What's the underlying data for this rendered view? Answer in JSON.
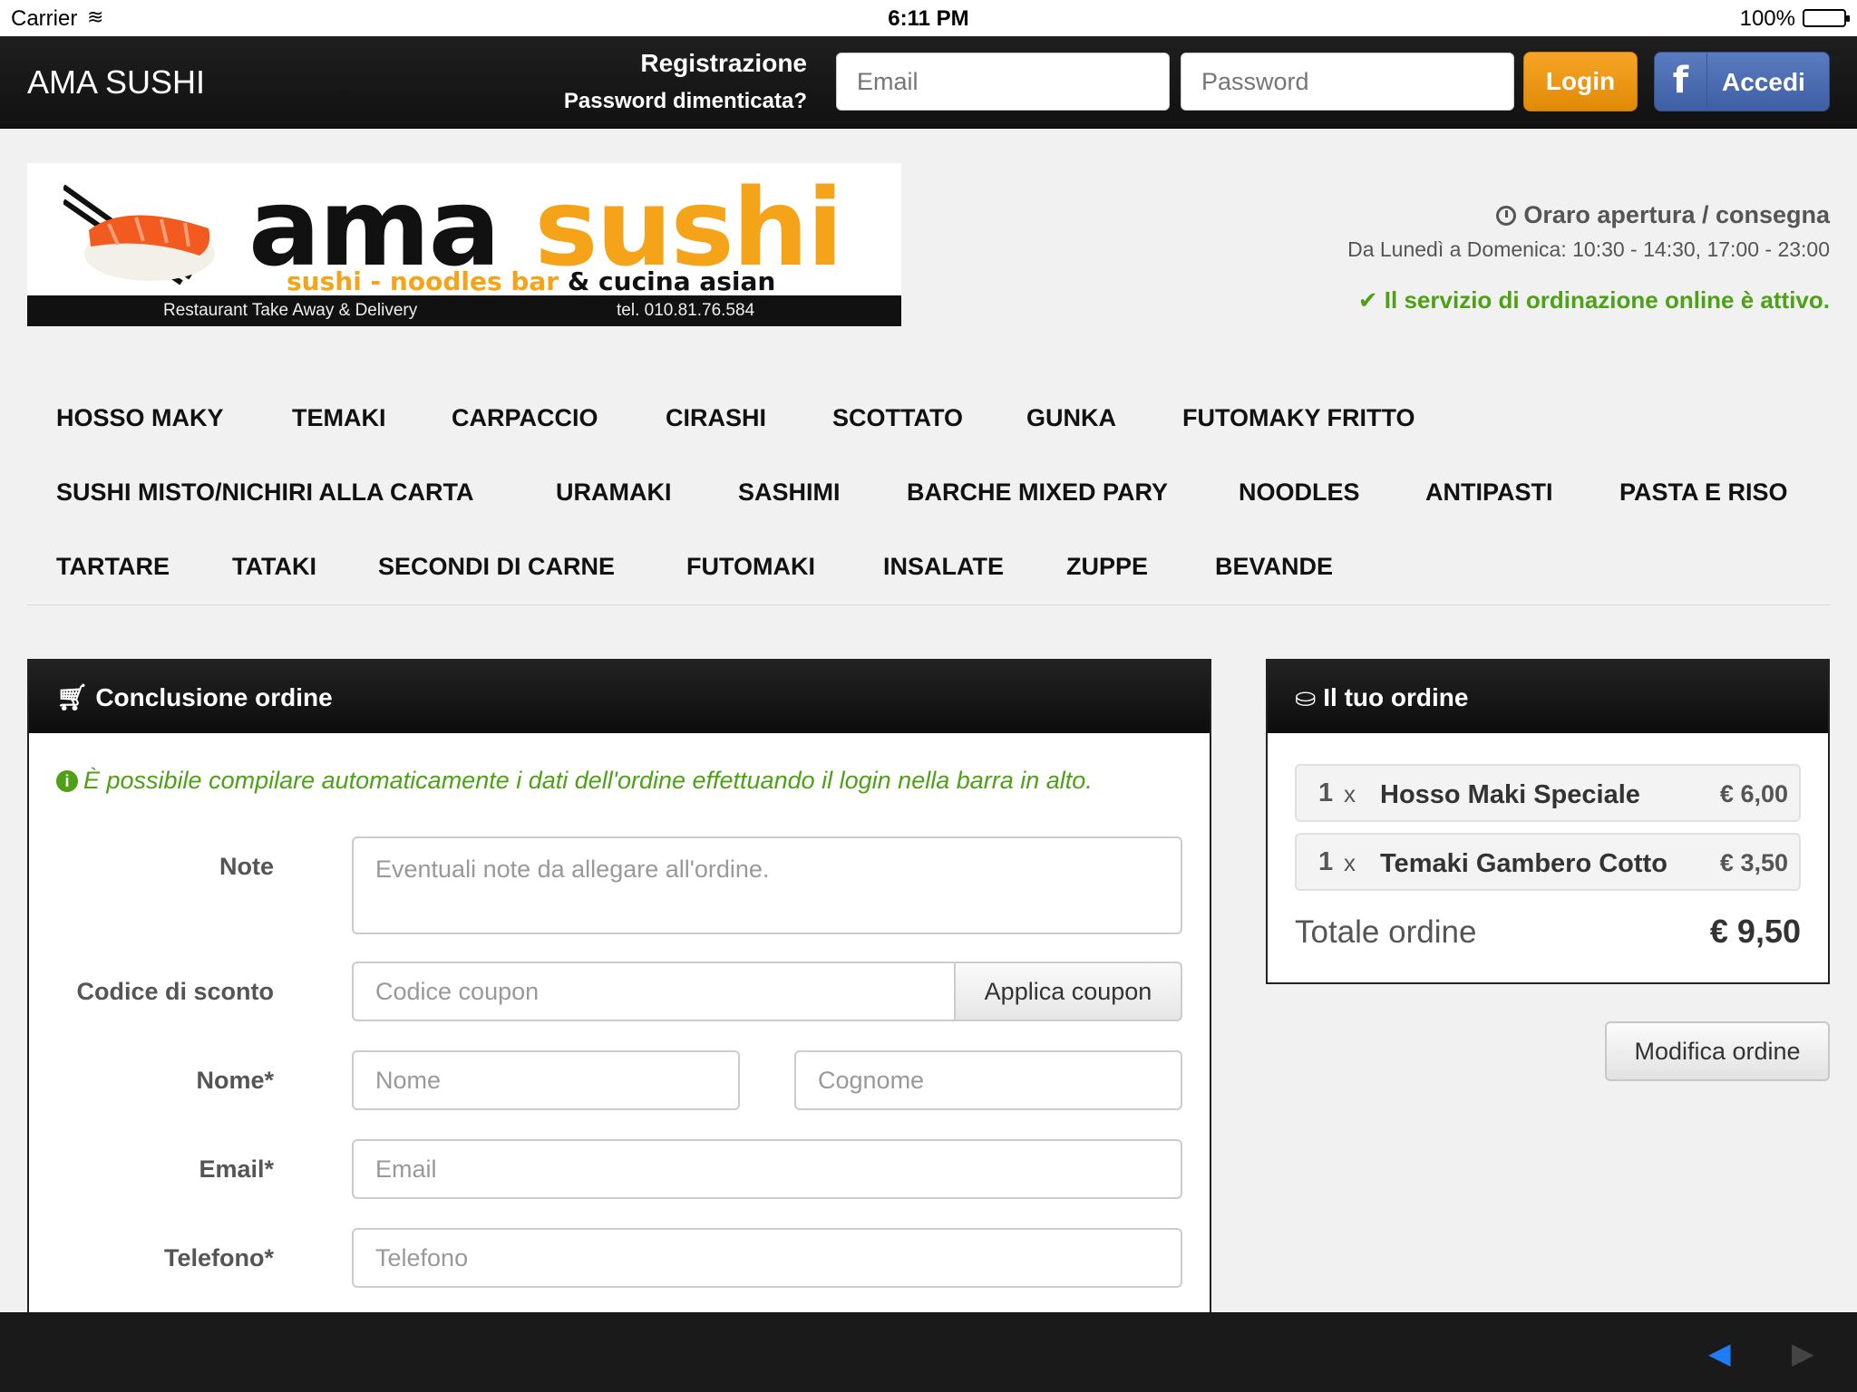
{
  "status_bar": {
    "carrier": "Carrier",
    "time": "6:11 PM",
    "battery": "100%"
  },
  "navbar": {
    "brand": "AMA SUSHI",
    "register": "Registrazione",
    "forgot_password": "Password dimenticata?",
    "email_placeholder": "Email",
    "password_placeholder": "Password",
    "login_label": "Login",
    "fb_label": "Accedi"
  },
  "logo": {
    "word_ama": "ama",
    "word_sushi": "sushi",
    "tagline_orange": "sushi - noodles bar",
    "tagline_dark": "& cucina asian",
    "takeaway": "Restaurant Take Away & Delivery",
    "tel": "tel. 010.81.76.584"
  },
  "hours": {
    "title": "Oraro apertura / consegna",
    "text": "Da Lunedì a Domenica: 10:30 - 14:30, 17:00 - 23:00",
    "service": "Il servizio di ordinazione online è attivo."
  },
  "categories": [
    "HOSSO MAKY",
    "TEMAKI",
    "CARPACCIO",
    "CIRASHI",
    "SCOTTATO",
    "GUNKA",
    "FUTOMAKY FRITTO",
    "SUSHI MISTO/NICHIRI ALLA CARTA",
    "URAMAKI",
    "SASHIMI",
    "BARCHE MIXED PARY",
    "NOODLES",
    "ANTIPASTI",
    "PASTA E RISO",
    "TARTARE",
    "TATAKI",
    "SECONDI DI CARNE",
    "FUTOMAKI",
    "INSALATE",
    "ZUPPE",
    "BEVANDE"
  ],
  "checkout": {
    "title": "Conclusione ordine",
    "info": "È possibile compilare automaticamente i dati dell'ordine effettuando il login nella barra in alto.",
    "note_label": "Note",
    "note_placeholder": "Eventuali note da allegare all'ordine.",
    "coupon_label": "Codice di sconto",
    "coupon_placeholder": "Codice coupon",
    "coupon_button": "Applica coupon",
    "name_label": "Nome*",
    "name_placeholder": "Nome",
    "surname_placeholder": "Cognome",
    "email_label": "Email*",
    "email_placeholder": "Email",
    "phone_label": "Telefono*",
    "phone_placeholder": "Telefono"
  },
  "order": {
    "title": "Il tuo ordine",
    "items": [
      {
        "qty": "1",
        "x": "x",
        "name": "Hosso Maki Speciale",
        "price": "€ 6,00"
      },
      {
        "qty": "1",
        "x": "x",
        "name": "Temaki Gambero Cotto",
        "price": "€ 3,50"
      }
    ],
    "total_label": "Totale ordine",
    "total_value": "€ 9,50",
    "edit_button": "Modifica ordine"
  }
}
